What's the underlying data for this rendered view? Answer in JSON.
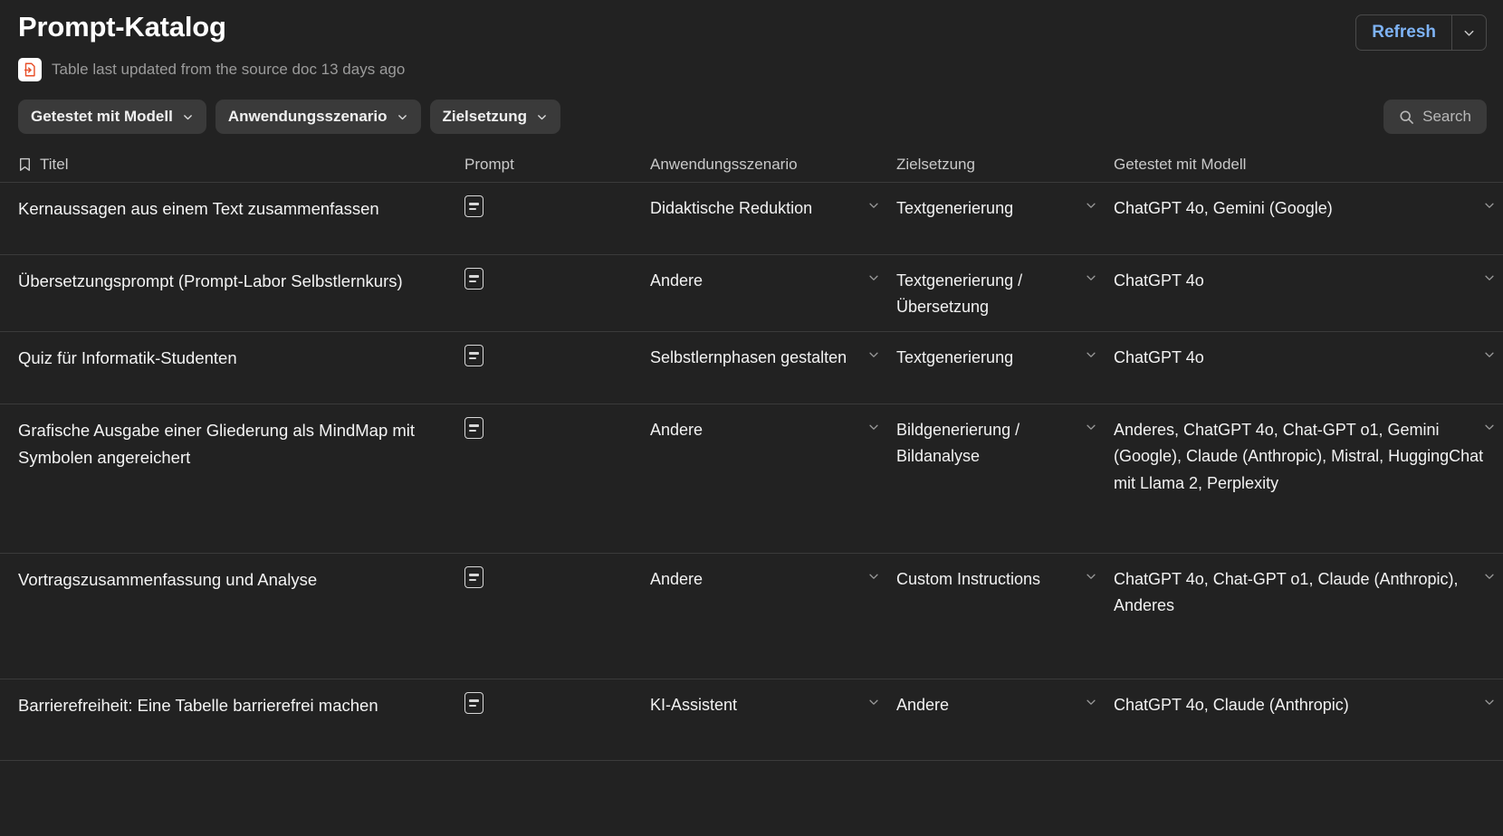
{
  "header": {
    "title": "Prompt-Katalog",
    "refresh_label": "Refresh",
    "refresh_caret_icon": "chevron-down-icon",
    "sync_icon": "doc-sync-icon",
    "sync_text": "Table last updated from the source doc 13 days ago"
  },
  "toolbar": {
    "filters": [
      {
        "label": "Getestet mit Modell",
        "caret_icon": "chevron-down-icon"
      },
      {
        "label": "Anwendungsszenario",
        "caret_icon": "chevron-down-icon"
      },
      {
        "label": "Zielsetzung",
        "caret_icon": "chevron-down-icon"
      }
    ],
    "search": {
      "label": "Search",
      "icon": "search-icon"
    }
  },
  "table": {
    "columns": [
      {
        "label": "Titel",
        "icon": "bookmark-icon"
      },
      {
        "label": "Prompt",
        "icon": null
      },
      {
        "label": "Anwendungsszenario",
        "icon": null
      },
      {
        "label": "Zielsetzung",
        "icon": null
      },
      {
        "label": "Getestet mit Modell",
        "icon": null
      }
    ],
    "prompt_cell_icon": "document-text-icon",
    "row_caret_icon": "chevron-down-icon",
    "rows": [
      {
        "titel": "Kernaussagen aus einem Text zusammenfassen",
        "anwendungsszenario": "Didaktische Reduktion",
        "zielsetzung": "Textgenerierung",
        "getestet_mit_modell": "ChatGPT 4o, Gemini (Google)"
      },
      {
        "titel": "Übersetzungsprompt (Prompt-Labor Selbstlernkurs)",
        "anwendungsszenario": "Andere",
        "zielsetzung": "Textgenerierung / Übersetzung",
        "getestet_mit_modell": "ChatGPT 4o"
      },
      {
        "titel": "Quiz für Informatik-Studenten",
        "anwendungsszenario": "Selbstlernphasen gestalten",
        "zielsetzung": "Textgenerierung",
        "getestet_mit_modell": "ChatGPT 4o"
      },
      {
        "titel": "Grafische Ausgabe einer Gliederung als MindMap mit Symbolen angereichert",
        "anwendungsszenario": "Andere",
        "zielsetzung": "Bildgenerierung / Bildanalyse",
        "getestet_mit_modell": "Anderes, ChatGPT 4o, Chat-GPT o1, Gemini (Google), Claude (Anthropic), Mistral, HuggingChat mit Llama 2, Perplexity"
      },
      {
        "titel": "Vortragszusammenfassung und Analyse",
        "anwendungsszenario": "Andere",
        "zielsetzung": "Custom Instructions",
        "getestet_mit_modell": "ChatGPT 4o, Chat-GPT o1, Claude (Anthropic), Anderes"
      },
      {
        "titel": "Barrierefreiheit: Eine Tabelle barrierefrei machen",
        "anwendungsszenario": "KI-Assistent",
        "zielsetzung": "Andere",
        "getestet_mit_modell": "ChatGPT 4o, Claude (Anthropic)"
      }
    ]
  },
  "colors": {
    "background": "#222222",
    "chip": "#3a3a3a",
    "accent_link": "#7eb3f5",
    "muted_text": "#9b9b9b",
    "divider": "#3b3b3b",
    "doc_badge_icon": "#e8502a"
  }
}
